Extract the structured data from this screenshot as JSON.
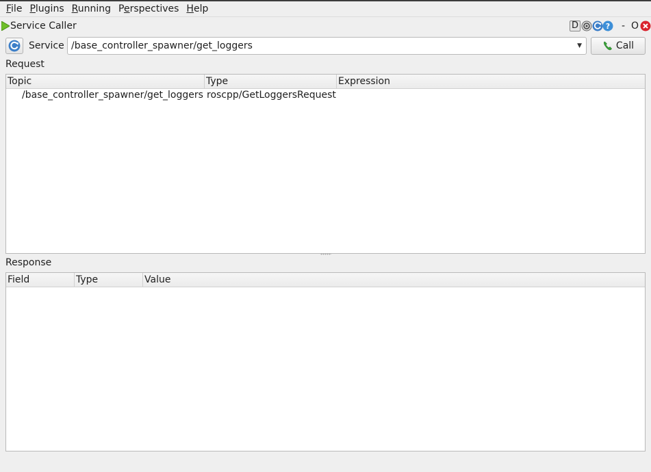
{
  "menubar": {
    "items": [
      {
        "label_u": "F",
        "label_rest": "ile"
      },
      {
        "label_u": "P",
        "label_rest": "lugins"
      },
      {
        "label_u": "R",
        "label_rest": "unning"
      },
      {
        "label_pre": "P",
        "label_u": "e",
        "label_rest": "rspectives"
      },
      {
        "label_u": "H",
        "label_rest": "elp"
      }
    ]
  },
  "titlebar": {
    "title": "Service Caller",
    "d_label": "D",
    "dash": "-",
    "o_label": "O"
  },
  "service": {
    "label": "Service",
    "selected": "/base_controller_spawner/get_loggers",
    "call_label": "Call"
  },
  "request": {
    "label": "Request",
    "columns": [
      "Topic",
      "Type",
      "Expression"
    ],
    "rows": [
      {
        "topic": "/base_controller_spawner/get_loggers",
        "type": "roscpp/GetLoggersRequest",
        "expression": ""
      }
    ]
  },
  "response": {
    "label": "Response",
    "columns": [
      "Field",
      "Type",
      "Value"
    ],
    "rows": []
  },
  "colors": {
    "play_green": "#6fbf2a",
    "close_red": "#d9232e",
    "help_blue": "#3d8fd8",
    "call_green": "#3aa53a"
  }
}
